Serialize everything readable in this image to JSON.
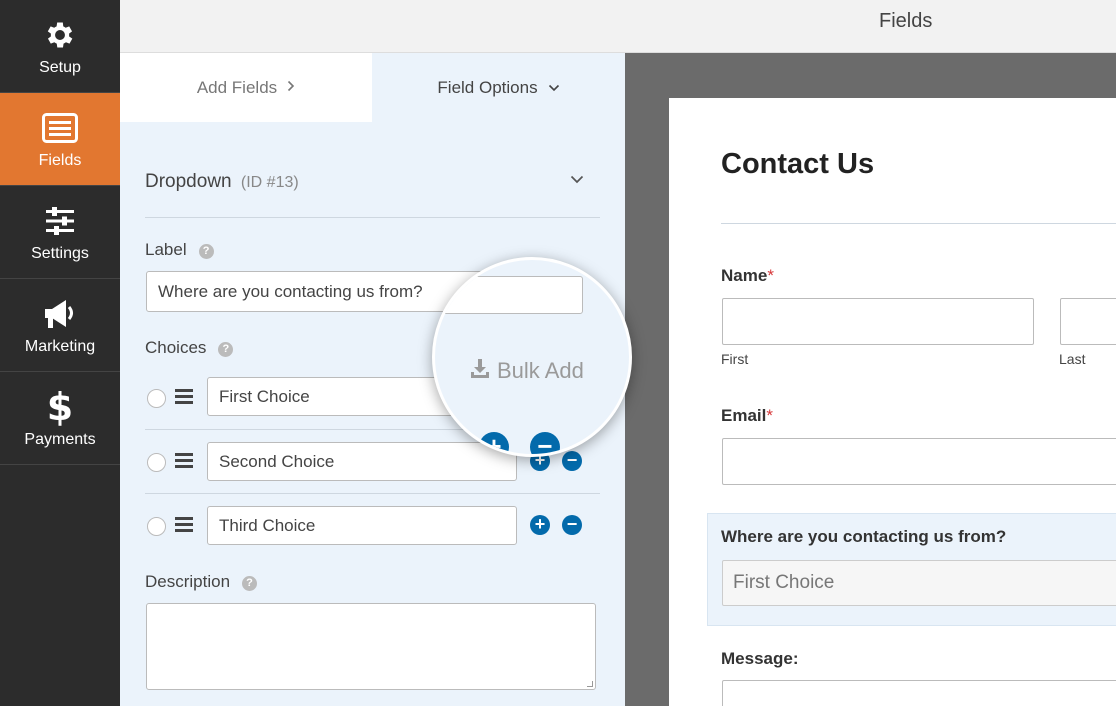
{
  "nav": {
    "items": [
      {
        "label": "Setup",
        "icon": "gear-icon"
      },
      {
        "label": "Fields",
        "icon": "list-icon"
      },
      {
        "label": "Settings",
        "icon": "sliders-icon"
      },
      {
        "label": "Marketing",
        "icon": "megaphone-icon"
      },
      {
        "label": "Payments",
        "icon": "dollar-icon"
      }
    ],
    "active": "Fields",
    "accent": "#e27730"
  },
  "topbar": {
    "title": "Fields"
  },
  "panel": {
    "tabs": [
      {
        "label": "Add Fields",
        "chevron": "›"
      },
      {
        "label": "Field Options",
        "chevron": "⌄"
      }
    ],
    "field": {
      "type": "Dropdown",
      "id_text": "(ID #13)"
    },
    "label_section": {
      "title": "Label",
      "value": "Where are you contacting us from?"
    },
    "choices_section": {
      "title": "Choices",
      "bulk_add": "Bulk Add",
      "choices": [
        "First Choice",
        "Second Choice",
        "Third Choice"
      ]
    },
    "description_section": {
      "title": "Description",
      "value": ""
    }
  },
  "preview": {
    "form_title": "Contact Us",
    "name_label": "Name",
    "name_first": "First",
    "name_last": "Last",
    "email_label": "Email",
    "required_mark": "*",
    "dropdown_label": "Where are you contacting us from?",
    "dropdown_value": "First Choice",
    "message_label": "Message:"
  },
  "colors": {
    "accent_blue": "#036aab",
    "panel_bg": "#ebf3fb",
    "required": "#d63638"
  }
}
